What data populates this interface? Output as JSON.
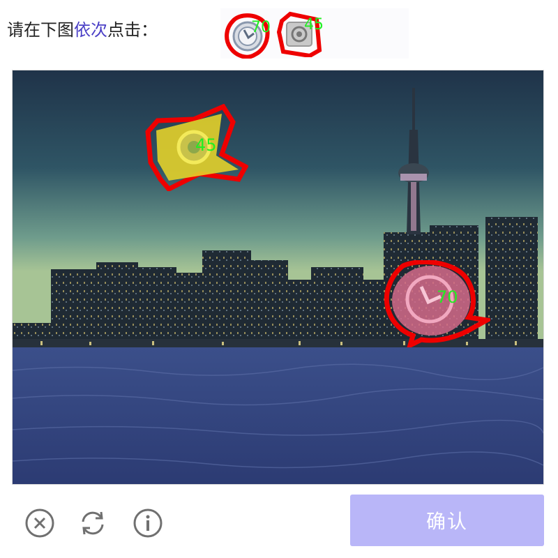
{
  "instruction": {
    "prefix": "请在下图",
    "highlight": "依次",
    "suffix": "点击："
  },
  "target_icons": [
    {
      "name": "clock-icon",
      "number": "70"
    },
    {
      "name": "target-icon",
      "number": "45"
    }
  ],
  "scene_icons": [
    {
      "name": "target-icon",
      "number": "45",
      "color": "#e3d02a"
    },
    {
      "name": "clock-icon",
      "number": "70",
      "color": "#d46a8a"
    }
  ],
  "footer": {
    "confirm_label": "确认",
    "icons": [
      "close-circle-icon",
      "refresh-icon",
      "info-icon"
    ]
  },
  "colors": {
    "highlight": "#4a3fc6",
    "annotation_red": "#ee0000",
    "annotation_green": "#22ee22",
    "confirm_bg": "#b9b6f8"
  }
}
